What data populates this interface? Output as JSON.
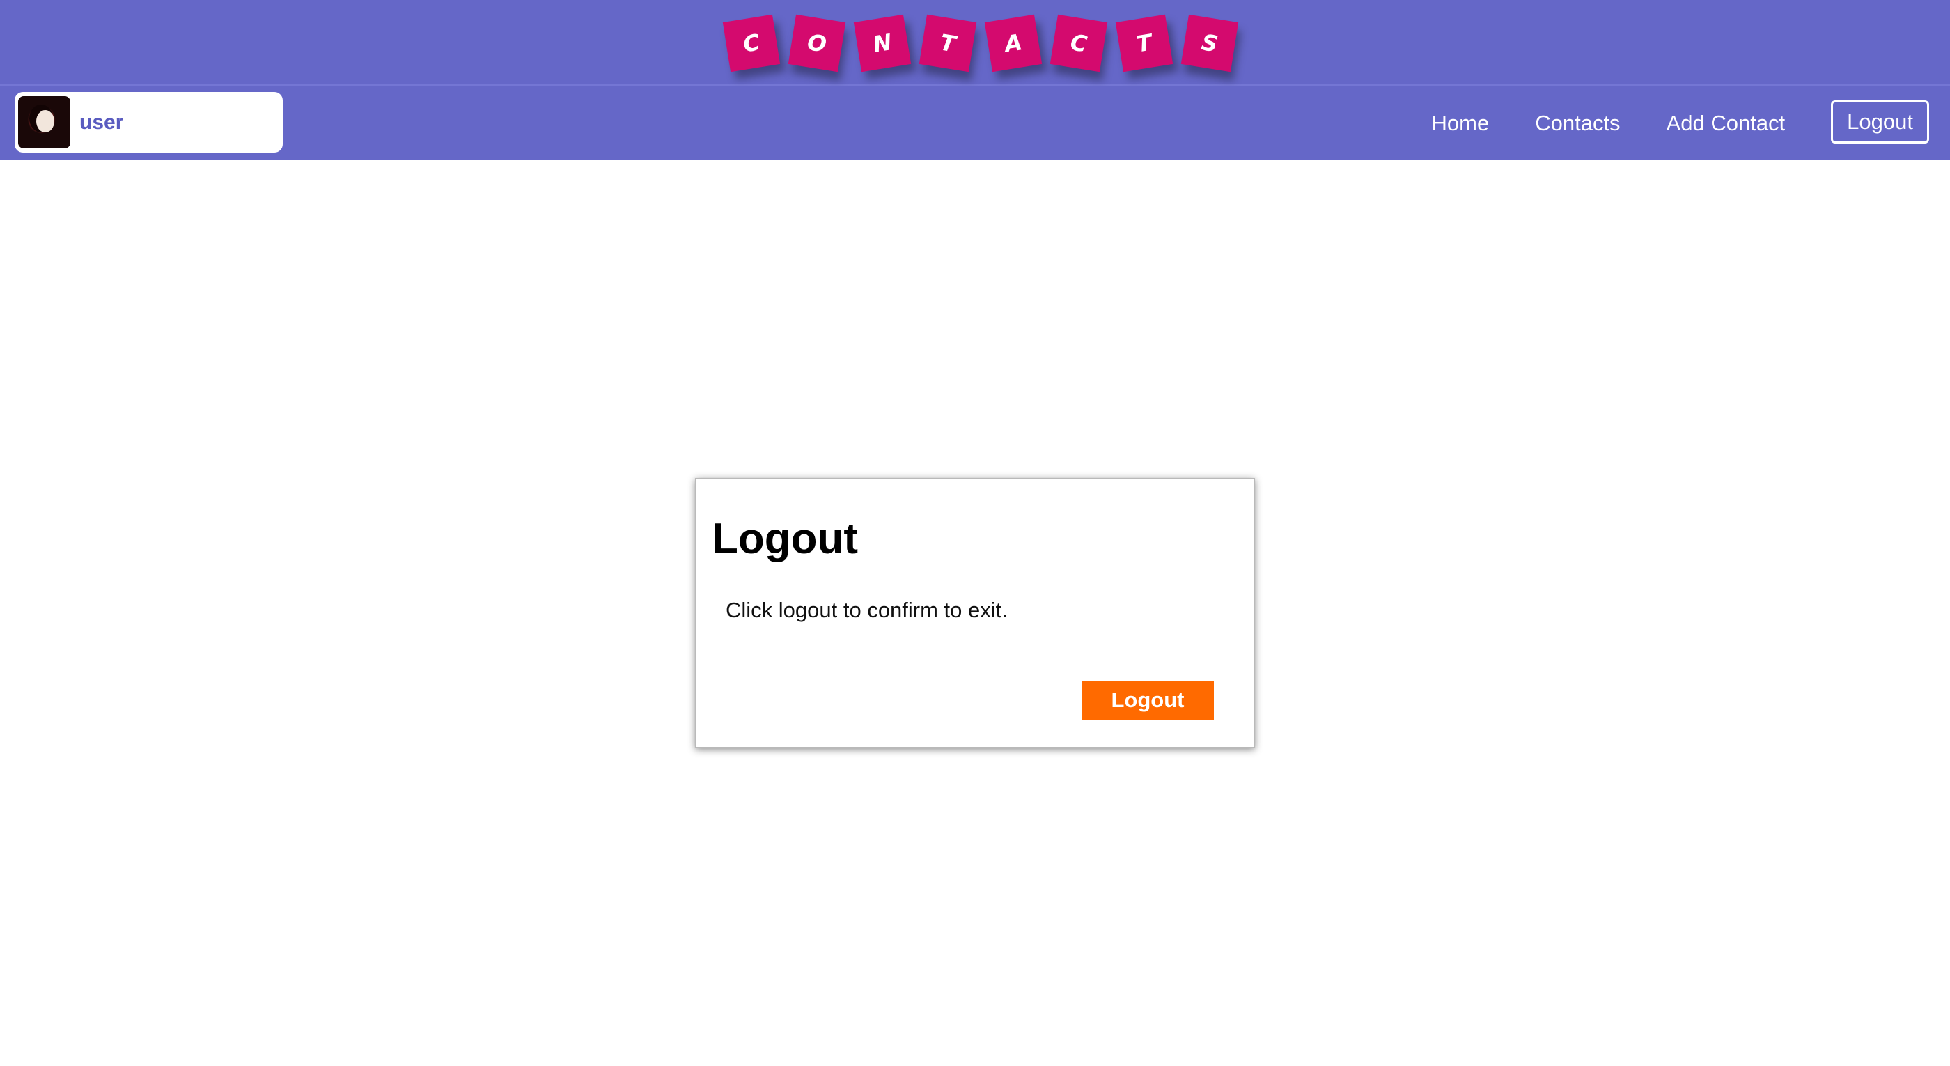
{
  "banner": {
    "letters": [
      "C",
      "O",
      "N",
      "T",
      "A",
      "C",
      "T",
      "S"
    ]
  },
  "navbar": {
    "username": "user",
    "links": [
      "Home",
      "Contacts",
      "Add Contact"
    ],
    "logout_label": "Logout"
  },
  "dialog": {
    "title": "Logout",
    "message": "Click logout to confirm to exit.",
    "confirm_label": "Logout"
  },
  "colors": {
    "header_bg": "#6567c8",
    "tile_bg": "#d40a6e",
    "confirm_button": "#ff6a00"
  }
}
